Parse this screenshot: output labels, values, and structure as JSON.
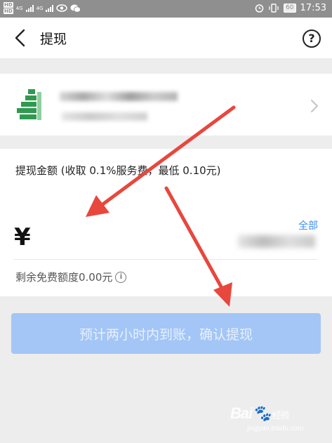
{
  "status_bar": {
    "left_labels": [
      "HD",
      "4G",
      "HD",
      "4G"
    ],
    "battery": "60",
    "time": "17:53"
  },
  "nav": {
    "title": "提现"
  },
  "amount": {
    "label": "提现金额 (收取 0.1%服务费，最低 0.10元)",
    "currency": "¥",
    "all_label": "全部",
    "quota": "剩余免费额度0.00元",
    "info_glyph": "i"
  },
  "confirm": {
    "label": "预计两小时内到账，确认提现"
  },
  "watermark": {
    "brand": "Bai",
    "brand2": "经验",
    "url": "jingyan.baidu.com"
  },
  "colors": {
    "accent": "#3b8ff3",
    "button_disabled": "#a3c6f7",
    "arrow": "#e8473d",
    "bank_green": "#2f9a4f"
  },
  "icons": [
    "back-arrow-icon",
    "help-icon",
    "bank-logo-icon",
    "chevron-right-icon",
    "info-icon",
    "eye-icon",
    "wechat-icon",
    "alarm-icon",
    "vibrate-icon"
  ]
}
